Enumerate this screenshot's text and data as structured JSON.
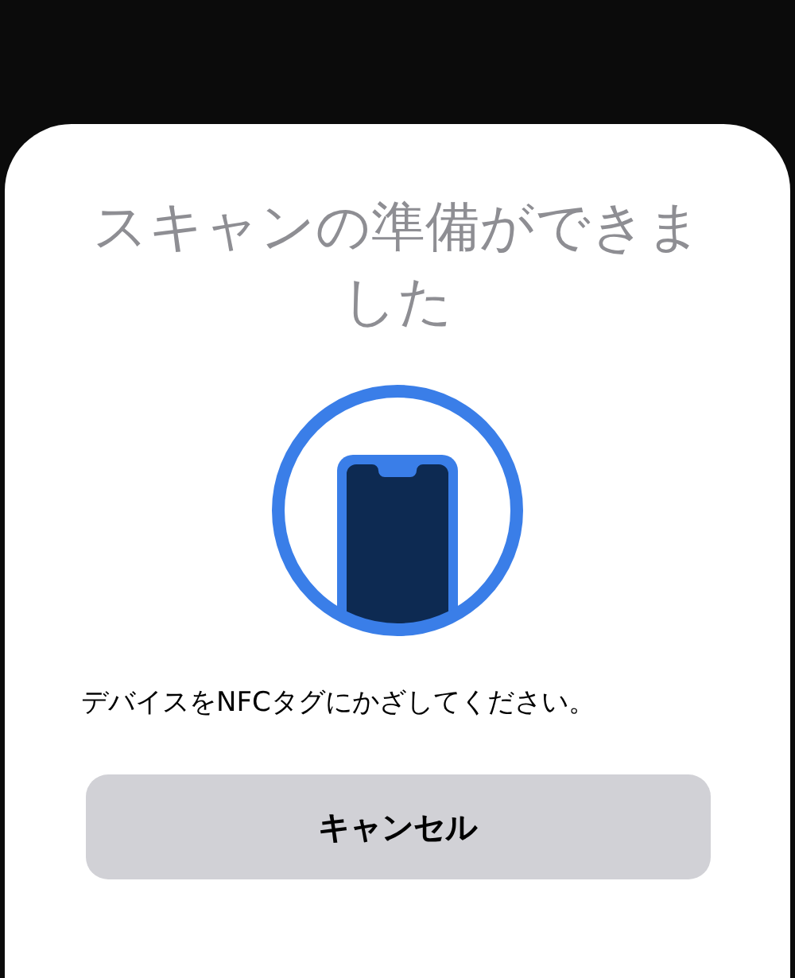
{
  "sheet": {
    "title": "スキャンの準備ができました",
    "message": "デバイスをNFCタグにかざしてください。",
    "buttons": [
      {
        "label": "キャンセル"
      }
    ]
  }
}
